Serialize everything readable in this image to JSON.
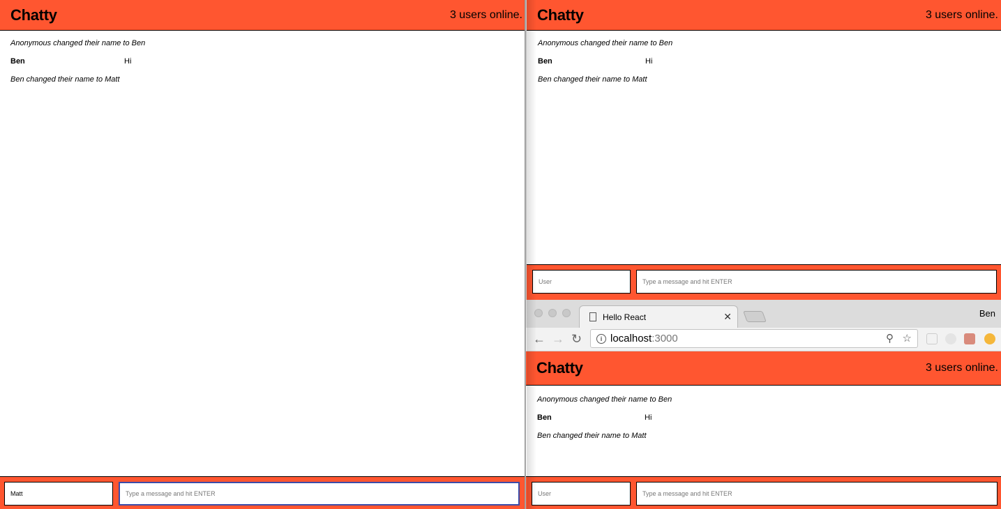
{
  "app": {
    "brand": "Chatty",
    "online": "3 users online.",
    "accent": "#ff5630"
  },
  "messages": [
    {
      "type": "system",
      "text": "Anonymous changed their name to Ben"
    },
    {
      "type": "chat",
      "user": "Ben",
      "text": "Hi"
    },
    {
      "type": "system",
      "text": "Ben changed their name to Matt"
    }
  ],
  "composer_left": {
    "username_value": "Matt",
    "message_placeholder": "Type a message and hit ENTER"
  },
  "composer_right": {
    "username_placeholder": "User",
    "message_placeholder": "Type a message and hit ENTER"
  },
  "browser": {
    "tab_title": "Hello React",
    "profile": "Ben",
    "url_host": "localhost",
    "url_port": ":3000",
    "icons": [
      "back-icon",
      "forward-icon",
      "reload-icon",
      "info-icon",
      "zoom-icon",
      "star-icon",
      "cast-icon",
      "extension-icon",
      "extension-icon",
      "extension-icon"
    ]
  }
}
